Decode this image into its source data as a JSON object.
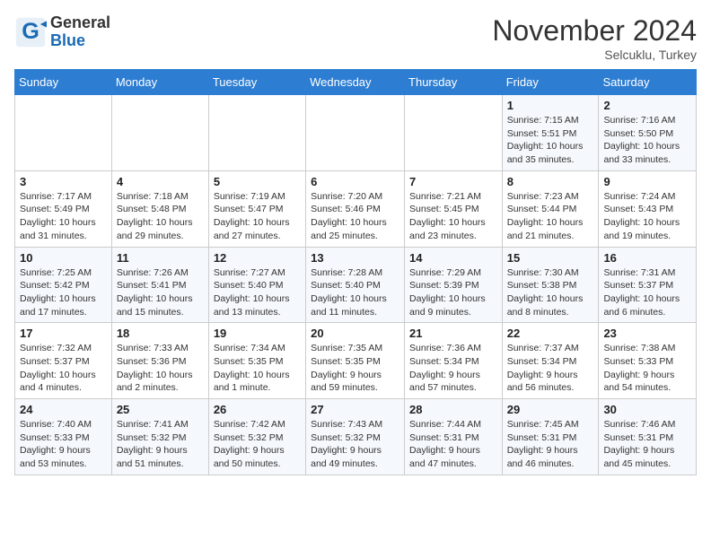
{
  "header": {
    "logo_general": "General",
    "logo_blue": "Blue",
    "month_title": "November 2024",
    "location": "Selcuklu, Turkey"
  },
  "days_of_week": [
    "Sunday",
    "Monday",
    "Tuesday",
    "Wednesday",
    "Thursday",
    "Friday",
    "Saturday"
  ],
  "weeks": [
    [
      {
        "day": "",
        "info": ""
      },
      {
        "day": "",
        "info": ""
      },
      {
        "day": "",
        "info": ""
      },
      {
        "day": "",
        "info": ""
      },
      {
        "day": "",
        "info": ""
      },
      {
        "day": "1",
        "info": "Sunrise: 7:15 AM\nSunset: 5:51 PM\nDaylight: 10 hours and 35 minutes."
      },
      {
        "day": "2",
        "info": "Sunrise: 7:16 AM\nSunset: 5:50 PM\nDaylight: 10 hours and 33 minutes."
      }
    ],
    [
      {
        "day": "3",
        "info": "Sunrise: 7:17 AM\nSunset: 5:49 PM\nDaylight: 10 hours and 31 minutes."
      },
      {
        "day": "4",
        "info": "Sunrise: 7:18 AM\nSunset: 5:48 PM\nDaylight: 10 hours and 29 minutes."
      },
      {
        "day": "5",
        "info": "Sunrise: 7:19 AM\nSunset: 5:47 PM\nDaylight: 10 hours and 27 minutes."
      },
      {
        "day": "6",
        "info": "Sunrise: 7:20 AM\nSunset: 5:46 PM\nDaylight: 10 hours and 25 minutes."
      },
      {
        "day": "7",
        "info": "Sunrise: 7:21 AM\nSunset: 5:45 PM\nDaylight: 10 hours and 23 minutes."
      },
      {
        "day": "8",
        "info": "Sunrise: 7:23 AM\nSunset: 5:44 PM\nDaylight: 10 hours and 21 minutes."
      },
      {
        "day": "9",
        "info": "Sunrise: 7:24 AM\nSunset: 5:43 PM\nDaylight: 10 hours and 19 minutes."
      }
    ],
    [
      {
        "day": "10",
        "info": "Sunrise: 7:25 AM\nSunset: 5:42 PM\nDaylight: 10 hours and 17 minutes."
      },
      {
        "day": "11",
        "info": "Sunrise: 7:26 AM\nSunset: 5:41 PM\nDaylight: 10 hours and 15 minutes."
      },
      {
        "day": "12",
        "info": "Sunrise: 7:27 AM\nSunset: 5:40 PM\nDaylight: 10 hours and 13 minutes."
      },
      {
        "day": "13",
        "info": "Sunrise: 7:28 AM\nSunset: 5:40 PM\nDaylight: 10 hours and 11 minutes."
      },
      {
        "day": "14",
        "info": "Sunrise: 7:29 AM\nSunset: 5:39 PM\nDaylight: 10 hours and 9 minutes."
      },
      {
        "day": "15",
        "info": "Sunrise: 7:30 AM\nSunset: 5:38 PM\nDaylight: 10 hours and 8 minutes."
      },
      {
        "day": "16",
        "info": "Sunrise: 7:31 AM\nSunset: 5:37 PM\nDaylight: 10 hours and 6 minutes."
      }
    ],
    [
      {
        "day": "17",
        "info": "Sunrise: 7:32 AM\nSunset: 5:37 PM\nDaylight: 10 hours and 4 minutes."
      },
      {
        "day": "18",
        "info": "Sunrise: 7:33 AM\nSunset: 5:36 PM\nDaylight: 10 hours and 2 minutes."
      },
      {
        "day": "19",
        "info": "Sunrise: 7:34 AM\nSunset: 5:35 PM\nDaylight: 10 hours and 1 minute."
      },
      {
        "day": "20",
        "info": "Sunrise: 7:35 AM\nSunset: 5:35 PM\nDaylight: 9 hours and 59 minutes."
      },
      {
        "day": "21",
        "info": "Sunrise: 7:36 AM\nSunset: 5:34 PM\nDaylight: 9 hours and 57 minutes."
      },
      {
        "day": "22",
        "info": "Sunrise: 7:37 AM\nSunset: 5:34 PM\nDaylight: 9 hours and 56 minutes."
      },
      {
        "day": "23",
        "info": "Sunrise: 7:38 AM\nSunset: 5:33 PM\nDaylight: 9 hours and 54 minutes."
      }
    ],
    [
      {
        "day": "24",
        "info": "Sunrise: 7:40 AM\nSunset: 5:33 PM\nDaylight: 9 hours and 53 minutes."
      },
      {
        "day": "25",
        "info": "Sunrise: 7:41 AM\nSunset: 5:32 PM\nDaylight: 9 hours and 51 minutes."
      },
      {
        "day": "26",
        "info": "Sunrise: 7:42 AM\nSunset: 5:32 PM\nDaylight: 9 hours and 50 minutes."
      },
      {
        "day": "27",
        "info": "Sunrise: 7:43 AM\nSunset: 5:32 PM\nDaylight: 9 hours and 49 minutes."
      },
      {
        "day": "28",
        "info": "Sunrise: 7:44 AM\nSunset: 5:31 PM\nDaylight: 9 hours and 47 minutes."
      },
      {
        "day": "29",
        "info": "Sunrise: 7:45 AM\nSunset: 5:31 PM\nDaylight: 9 hours and 46 minutes."
      },
      {
        "day": "30",
        "info": "Sunrise: 7:46 AM\nSunset: 5:31 PM\nDaylight: 9 hours and 45 minutes."
      }
    ]
  ]
}
